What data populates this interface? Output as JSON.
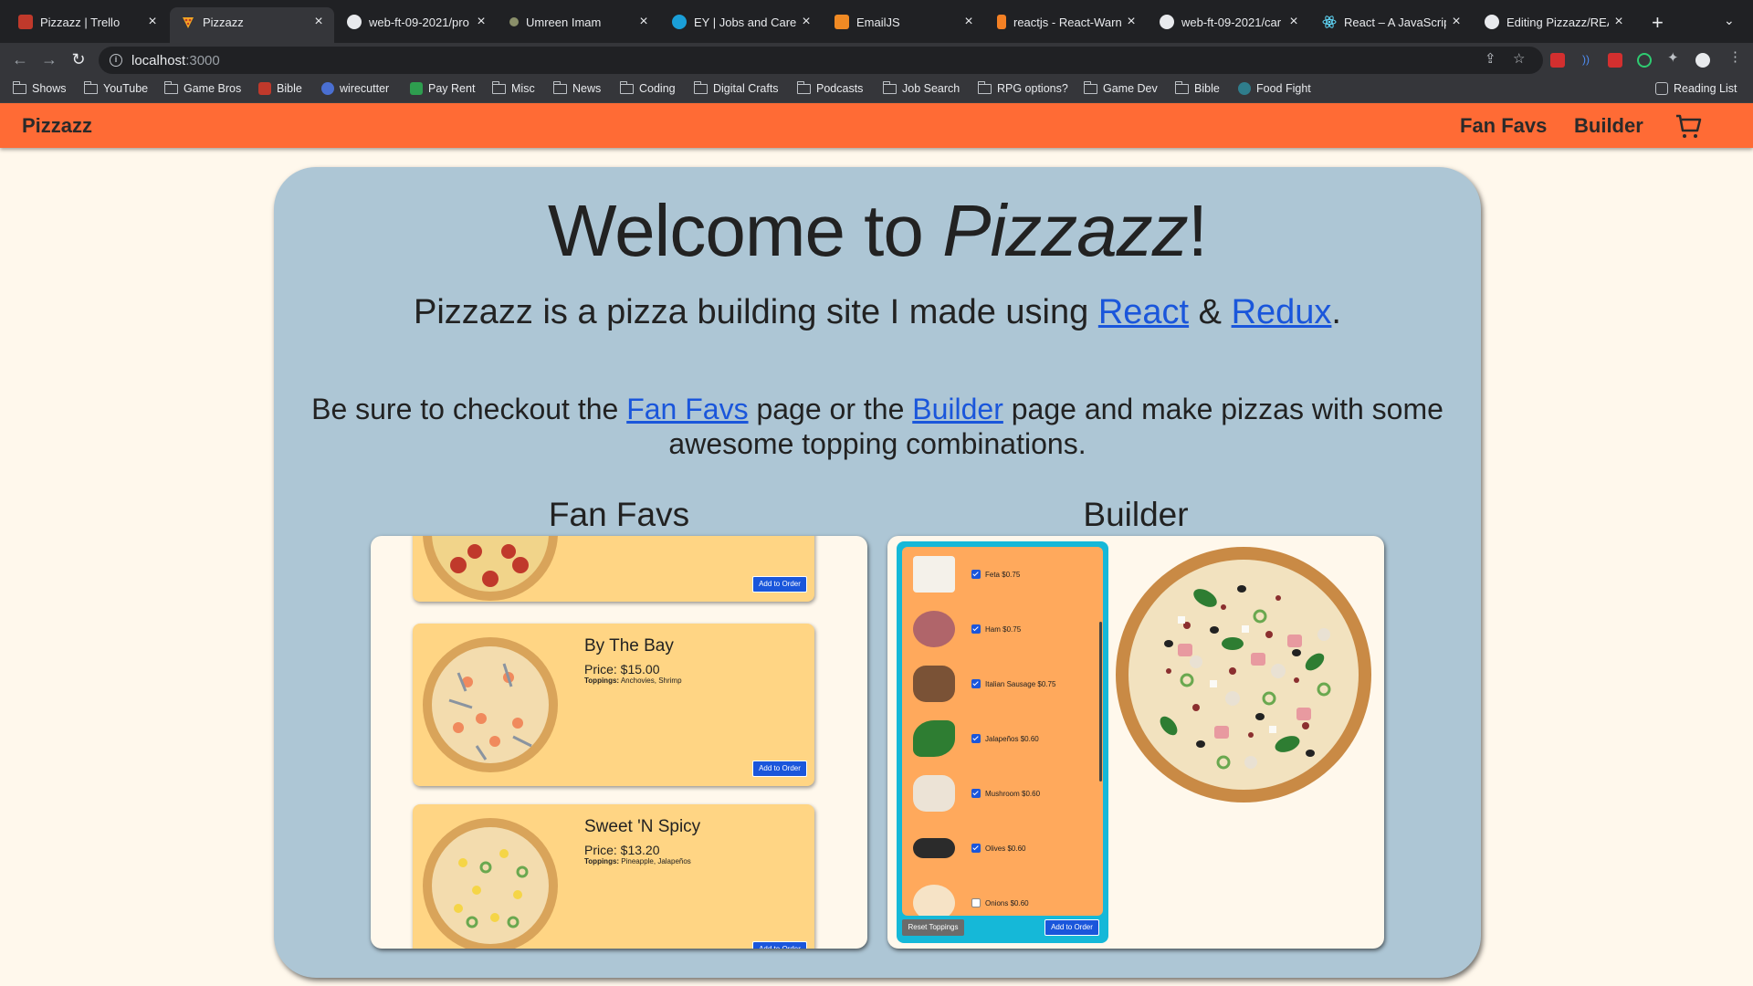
{
  "browser": {
    "tabs": [
      {
        "title": "Pizzazz | Trello",
        "favicon": "trello-icon",
        "active": false
      },
      {
        "title": "Pizzazz",
        "favicon": "pizza-icon",
        "active": true
      },
      {
        "title": "web-ft-09-2021/pro",
        "favicon": "github-icon",
        "active": false
      },
      {
        "title": "Umreen Imam",
        "favicon": "profile-icon",
        "active": false
      },
      {
        "title": "EY | Jobs and Caree",
        "favicon": "ey-icon",
        "active": false
      },
      {
        "title": "EmailJS",
        "favicon": "emailjs-icon",
        "active": false
      },
      {
        "title": "reactjs - React-Warn",
        "favicon": "stackoverflow-icon",
        "active": false
      },
      {
        "title": "web-ft-09-2021/car",
        "favicon": "github-icon",
        "active": false
      },
      {
        "title": "React – A JavaScrip",
        "favicon": "react-icon",
        "active": false
      },
      {
        "title": "Editing Pizzazz/REA",
        "favicon": "github-icon",
        "active": false
      }
    ],
    "url_host": "localhost",
    "url_port": ":3000",
    "bookmarks": [
      {
        "label": "Shows",
        "type": "folder"
      },
      {
        "label": "YouTube",
        "type": "folder"
      },
      {
        "label": "Game Bros",
        "type": "folder"
      },
      {
        "label": "Bible",
        "type": "site",
        "color": "#c0392b"
      },
      {
        "label": "wirecutter",
        "type": "site",
        "color": "#4a6fd1"
      },
      {
        "label": "Pay Rent",
        "type": "site",
        "color": "#2e9e4f"
      },
      {
        "label": "Misc",
        "type": "folder"
      },
      {
        "label": "News",
        "type": "folder"
      },
      {
        "label": "Coding",
        "type": "folder"
      },
      {
        "label": "Digital Crafts",
        "type": "folder"
      },
      {
        "label": "Podcasts",
        "type": "folder"
      },
      {
        "label": "Job Search",
        "type": "folder"
      },
      {
        "label": "RPG options?",
        "type": "folder"
      },
      {
        "label": "Game Dev",
        "type": "folder"
      },
      {
        "label": "Bible",
        "type": "folder"
      },
      {
        "label": "Food Fight",
        "type": "site",
        "color": "#2f7d8c"
      }
    ],
    "reading_list": "Reading List"
  },
  "app": {
    "brand": "Pizzazz",
    "nav": {
      "fan_favs": "Fan Favs",
      "builder": "Builder"
    },
    "hero": {
      "title_prefix": "Welcome to ",
      "title_italic": "Pizzazz",
      "title_suffix": "!",
      "sub_prefix": "Pizzazz is a pizza building site I made using ",
      "react": "React",
      "amp": " & ",
      "redux": "Redux",
      "sub_suffix": ".",
      "cta_prefix": "Be sure to checkout the ",
      "cta_fan_favs": "Fan Favs",
      "cta_middle": " page or the ",
      "cta_builder": "Builder",
      "cta_suffix": " page and make pizzas with some awesome topping combinations."
    },
    "fan_favs": {
      "heading": "Fan Favs",
      "pizzas": [
        {
          "name": "By The Bay",
          "price": "Price: $15.00",
          "toppings_label": "Toppings:",
          "toppings": "Anchovies, Shrimp",
          "button": "Add to Order"
        },
        {
          "name": "Sweet 'N Spicy",
          "price": "Price: $13.20",
          "toppings_label": "Toppings:",
          "toppings": "Pineapple, Jalapeños",
          "button": "Add to Order"
        }
      ],
      "top_card_button": "Add to Order"
    },
    "builder": {
      "heading": "Builder",
      "toppings": [
        {
          "label": "Feta",
          "price": "$0.75",
          "checked": true,
          "icon": "feta-icon"
        },
        {
          "label": "Ham",
          "price": "$0.75",
          "checked": true,
          "icon": "ham-icon"
        },
        {
          "label": "Italian Sausage",
          "price": "$0.75",
          "checked": true,
          "icon": "sausage-icon"
        },
        {
          "label": "Jalapeños",
          "price": "$0.60",
          "checked": true,
          "icon": "jalapeno-icon"
        },
        {
          "label": "Mushroom",
          "price": "$0.60",
          "checked": true,
          "icon": "mushroom-icon"
        },
        {
          "label": "Olives",
          "price": "$0.60",
          "checked": true,
          "icon": "olives-icon"
        },
        {
          "label": "Onions",
          "price": "$0.60",
          "checked": false,
          "icon": "onion-icon"
        }
      ],
      "reset_button": "Reset Toppings",
      "add_button": "Add to Order"
    }
  }
}
